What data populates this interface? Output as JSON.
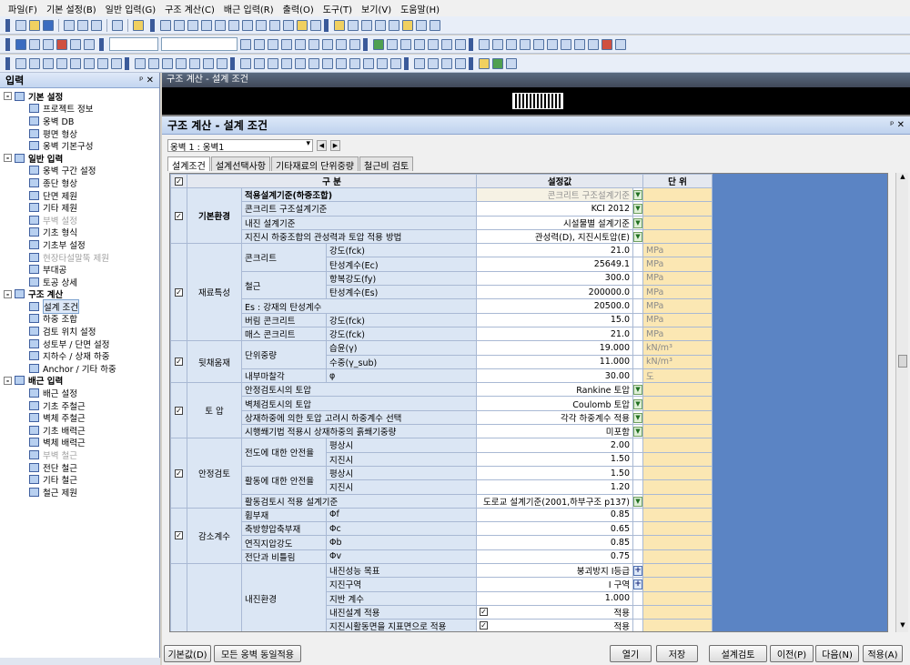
{
  "menu": [
    "파일(F)",
    "기본 설정(B)",
    "일반 입력(G)",
    "구조 계산(C)",
    "배근 입력(R)",
    "출력(O)",
    "도구(T)",
    "보기(V)",
    "도움말(H)"
  ],
  "left_panel": {
    "title": "입력",
    "pin": "ᵖ",
    "close": "✕",
    "tree": [
      {
        "label": "기본 설정",
        "level": 0,
        "expander": "-"
      },
      {
        "label": "프로젝트 정보",
        "level": 1
      },
      {
        "label": "옹벽 DB",
        "level": 1
      },
      {
        "label": "평면 형상",
        "level": 1
      },
      {
        "label": "옹벽 기본구성",
        "level": 1
      },
      {
        "label": "일반 입력",
        "level": 0,
        "expander": "-"
      },
      {
        "label": "옹벽 구간 설정",
        "level": 1
      },
      {
        "label": "종단 형상",
        "level": 1
      },
      {
        "label": "단면 제원",
        "level": 1
      },
      {
        "label": "기타 제원",
        "level": 1
      },
      {
        "label": "부벽 설정",
        "level": 1,
        "disabled": true
      },
      {
        "label": "기초 형식",
        "level": 1
      },
      {
        "label": "기초부 설정",
        "level": 1
      },
      {
        "label": "현장타설말뚝 제원",
        "level": 1,
        "disabled": true
      },
      {
        "label": "부대공",
        "level": 1
      },
      {
        "label": "토공 상세",
        "level": 1
      },
      {
        "label": "구조 계산",
        "level": 0,
        "expander": "-"
      },
      {
        "label": "설계 조건",
        "level": 1,
        "selected": true
      },
      {
        "label": "하중 조합",
        "level": 1
      },
      {
        "label": "검토 위치 설정",
        "level": 1
      },
      {
        "label": "성토부 / 단면 설정",
        "level": 1
      },
      {
        "label": "지하수 / 상재 하중",
        "level": 1
      },
      {
        "label": "Anchor / 기타 하중",
        "level": 1
      },
      {
        "label": "배근 입력",
        "level": 0,
        "expander": "-"
      },
      {
        "label": "배근 설정",
        "level": 1
      },
      {
        "label": "기초 주철근",
        "level": 1
      },
      {
        "label": "벽체 주철근",
        "level": 1
      },
      {
        "label": "기초 배력근",
        "level": 1
      },
      {
        "label": "벽체 배력근",
        "level": 1
      },
      {
        "label": "부벽 철근",
        "level": 1,
        "disabled": true
      },
      {
        "label": "전단 철근",
        "level": 1
      },
      {
        "label": "기타 철근",
        "level": 1
      },
      {
        "label": "철근 제원",
        "level": 1
      }
    ]
  },
  "doc_title": "구조 계산 - 설계 조건",
  "dialog": {
    "title": "구조 계산 - 설계 조건",
    "wall_select": "옹벽 1 : 옹벽1",
    "tabs": [
      "설계조건",
      "설계선택사항",
      "기타재료의 단위중량",
      "철근비 검토"
    ],
    "headers": {
      "category": "구 분",
      "value": "설정값",
      "unit": "단 위"
    },
    "groups": [
      {
        "name": "기본환경",
        "rows": [
          {
            "label": "적용설계기준(하중조합)",
            "value": "콘크리트 구조설계기준",
            "dd": true,
            "bold": true,
            "grey": true
          },
          {
            "label": "콘크리트 구조설계기준",
            "value": "KCI 2012",
            "dd": true
          },
          {
            "label": "내진 설계기준",
            "value": "시설물별 설계기준",
            "dd": true
          },
          {
            "label": "지진시 하중조합의 관성력과 토압 적용 방법",
            "value": "관성력(D), 지진시토압(E)",
            "dd": true
          }
        ]
      },
      {
        "name": "재료특성",
        "rows": [
          {
            "label": "콘크리트",
            "sub": "강도(fck)",
            "value": "21.0",
            "unit": "MPa"
          },
          {
            "label": "",
            "sub": "탄성계수(Ec)",
            "value": "25649.1",
            "unit": "MPa"
          },
          {
            "label": "철근",
            "sub": "항복강도(fy)",
            "value": "300.0",
            "unit": "MPa"
          },
          {
            "label": "",
            "sub": "탄성계수(Es)",
            "value": "200000.0",
            "unit": "MPa"
          },
          {
            "label": "Es : 강재의 탄성계수",
            "sub": "",
            "value": "20500.0",
            "unit": "MPa"
          },
          {
            "label": "버림 콘크리트",
            "sub": "강도(fck)",
            "value": "15.0",
            "unit": "MPa"
          },
          {
            "label": "매스 콘크리트",
            "sub": "강도(fck)",
            "value": "21.0",
            "unit": "MPa"
          }
        ]
      },
      {
        "name": "뒷채움재",
        "rows": [
          {
            "label": "단위중량",
            "sub": "습윤(γ)",
            "value": "19.000",
            "unit": "kN/m³"
          },
          {
            "label": "",
            "sub": "수중(γ_sub)",
            "value": "11.000",
            "unit": "kN/m³"
          },
          {
            "label": "내부마찰각",
            "sub": "φ",
            "value": "30.00",
            "unit": "도"
          }
        ]
      },
      {
        "name": "토 압",
        "rows": [
          {
            "label": "안정검토시의 토압",
            "value": "Rankine 토압",
            "dd": true
          },
          {
            "label": "벽체검토시의 토압",
            "value": "Coulomb 토압",
            "dd": true
          },
          {
            "label": "상재하중에 의한 토압 고려시 하중계수 선택",
            "value": "각각 하중계수 적용",
            "dd": true
          },
          {
            "label": "시행쐐기법 적용시 상재하중의 흙쐐기중량",
            "value": "미포함",
            "dd": true
          }
        ]
      },
      {
        "name": "안정검토",
        "rows": [
          {
            "label": "전도에 대한 안전율",
            "sub": "평상시",
            "value": "2.00"
          },
          {
            "label": "",
            "sub": "지진시",
            "value": "1.50"
          },
          {
            "label": "활동에 대한 안전율",
            "sub": "평상시",
            "value": "1.50"
          },
          {
            "label": "",
            "sub": "지진시",
            "value": "1.20"
          },
          {
            "label": "활동검토시 적용 설계기준",
            "value": "도로교 설계기준(2001,하부구조 p137)",
            "dd": true
          }
        ]
      },
      {
        "name": "감소계수",
        "rows": [
          {
            "label": "휨부재",
            "sub": "Φf",
            "value": "0.85"
          },
          {
            "label": "축방향압축부재",
            "sub": "Φc",
            "value": "0.65"
          },
          {
            "label": "연직지압강도",
            "sub": "Φb",
            "value": "0.85"
          },
          {
            "label": "전단과 비틀림",
            "sub": "Φv",
            "value": "0.75"
          }
        ]
      },
      {
        "name": "",
        "rows": [
          {
            "label": "내진환경",
            "sub": "내진성능 목표",
            "value": "붕괴방지 I등급",
            "plus": true
          },
          {
            "label": "",
            "sub": "지진구역",
            "value": "I 구역",
            "plus": true
          },
          {
            "label": "",
            "sub": "지반 계수",
            "value": "1.000"
          },
          {
            "label": "",
            "sub": "내진설계 적용",
            "value": "적용",
            "check": true
          },
          {
            "label": "",
            "sub": "지진시활동면을 지표면으로 적용",
            "value": "적용",
            "check": true
          }
        ]
      }
    ],
    "buttons": {
      "default": "기본값(D)",
      "apply_all": "모든 옹벽 동일적용",
      "open": "열기",
      "save": "저장",
      "design_check": "설계검토",
      "prev": "이전(P)",
      "next": "다음(N)",
      "apply": "적용(A)"
    }
  }
}
